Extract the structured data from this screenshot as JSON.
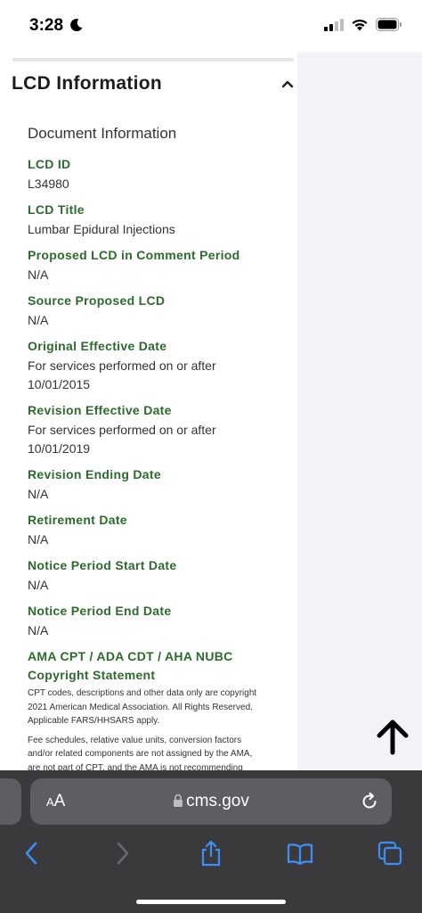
{
  "status_bar": {
    "time": "3:28",
    "icons": [
      "moon-icon",
      "cellular-signal-icon",
      "wifi-icon",
      "battery-icon"
    ]
  },
  "section": {
    "title": "LCD Information",
    "collapse_icon": "chevron-up-icon"
  },
  "document_info": {
    "title": "Document Information",
    "fields": [
      {
        "label": "LCD ID",
        "value": "L34980"
      },
      {
        "label": "LCD Title",
        "value": "Lumbar Epidural Injections"
      },
      {
        "label": "Proposed LCD in Comment Period",
        "value": "N/A"
      },
      {
        "label": "Source Proposed LCD",
        "value": "N/A"
      },
      {
        "label": "Original Effective Date",
        "value_line1": "For services performed on or after",
        "value_line2": "10/01/2015"
      },
      {
        "label": "Revision Effective Date",
        "value_line1": "For services performed on or after",
        "value_line2": "10/01/2019"
      },
      {
        "label": "Revision Ending Date",
        "value": "N/A"
      },
      {
        "label": "Retirement Date",
        "value": "N/A"
      },
      {
        "label": "Notice Period Start Date",
        "value": "N/A"
      },
      {
        "label": "Notice Period End Date",
        "value": "N/A"
      }
    ],
    "copyright": {
      "label_line1": "AMA CPT / ADA CDT / AHA NUBC",
      "label_line2": "Copyright Statement",
      "para1": [
        "CPT codes, descriptions and other data only are copyright",
        "2021 American Medical Association. All Rights Reserved.",
        "Applicable FARS/HHSARS apply."
      ],
      "para2": [
        "Fee schedules, relative value units, conversion factors",
        "and/or related components are not assigned by the AMA,",
        "are not part of CPT, and the AMA is not recommending"
      ]
    }
  },
  "scroll_top_icon": "arrow-up-icon",
  "browser": {
    "aa_large": "A",
    "aa_small": "A",
    "url": "cms.gov",
    "lock_icon": "lock-icon",
    "reload_icon": "reload-icon",
    "toolbar": [
      "back-icon",
      "forward-icon",
      "share-icon",
      "bookmarks-icon",
      "tabs-icon"
    ]
  },
  "colors": {
    "label_green": "#2d6a2d",
    "browser_bg": "#3a3a3c",
    "url_pill": "#5e5e62",
    "toolbar_blue": "#3e8ef7"
  }
}
